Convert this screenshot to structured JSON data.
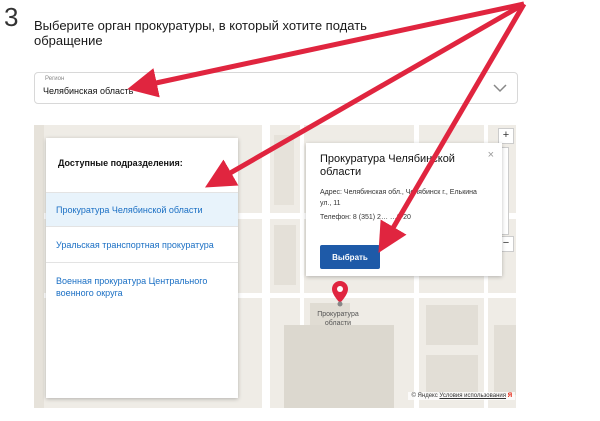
{
  "step": {
    "number": "3"
  },
  "heading": {
    "text": "Выберите орган прокуратуры, в который хотите подать обращение"
  },
  "region_select": {
    "label": "Регион",
    "value": "Челябинская область"
  },
  "units_panel": {
    "title": "Доступные подразделения:",
    "items": [
      {
        "label": "Прокуратура Челябинской области",
        "selected": true
      },
      {
        "label": "Уральская транспортная прокуратура",
        "selected": false
      },
      {
        "label": "Военная прокуратура Центрального военного округа",
        "selected": false
      }
    ]
  },
  "info_card": {
    "title": "Прокуратура Челябинской области",
    "address": "Адрес: Челябинская обл., Челябинск г., Елькина ул., 11",
    "phone": "Телефон: 8 (351) 2… …0-20",
    "button_label": "Выбрать",
    "close_symbol": "×"
  },
  "map": {
    "zoom_in": "+",
    "zoom_out": "−",
    "marker_label": "Прокуратура области",
    "footer_copyright": "© Яндекс",
    "footer_terms": "Условия использования",
    "footer_logo": "Я"
  },
  "colors": {
    "accent": "#1e5aa8",
    "link": "#1a6fc4",
    "arrow": "#e0253f",
    "selected_bg": "#e8f3fb"
  }
}
